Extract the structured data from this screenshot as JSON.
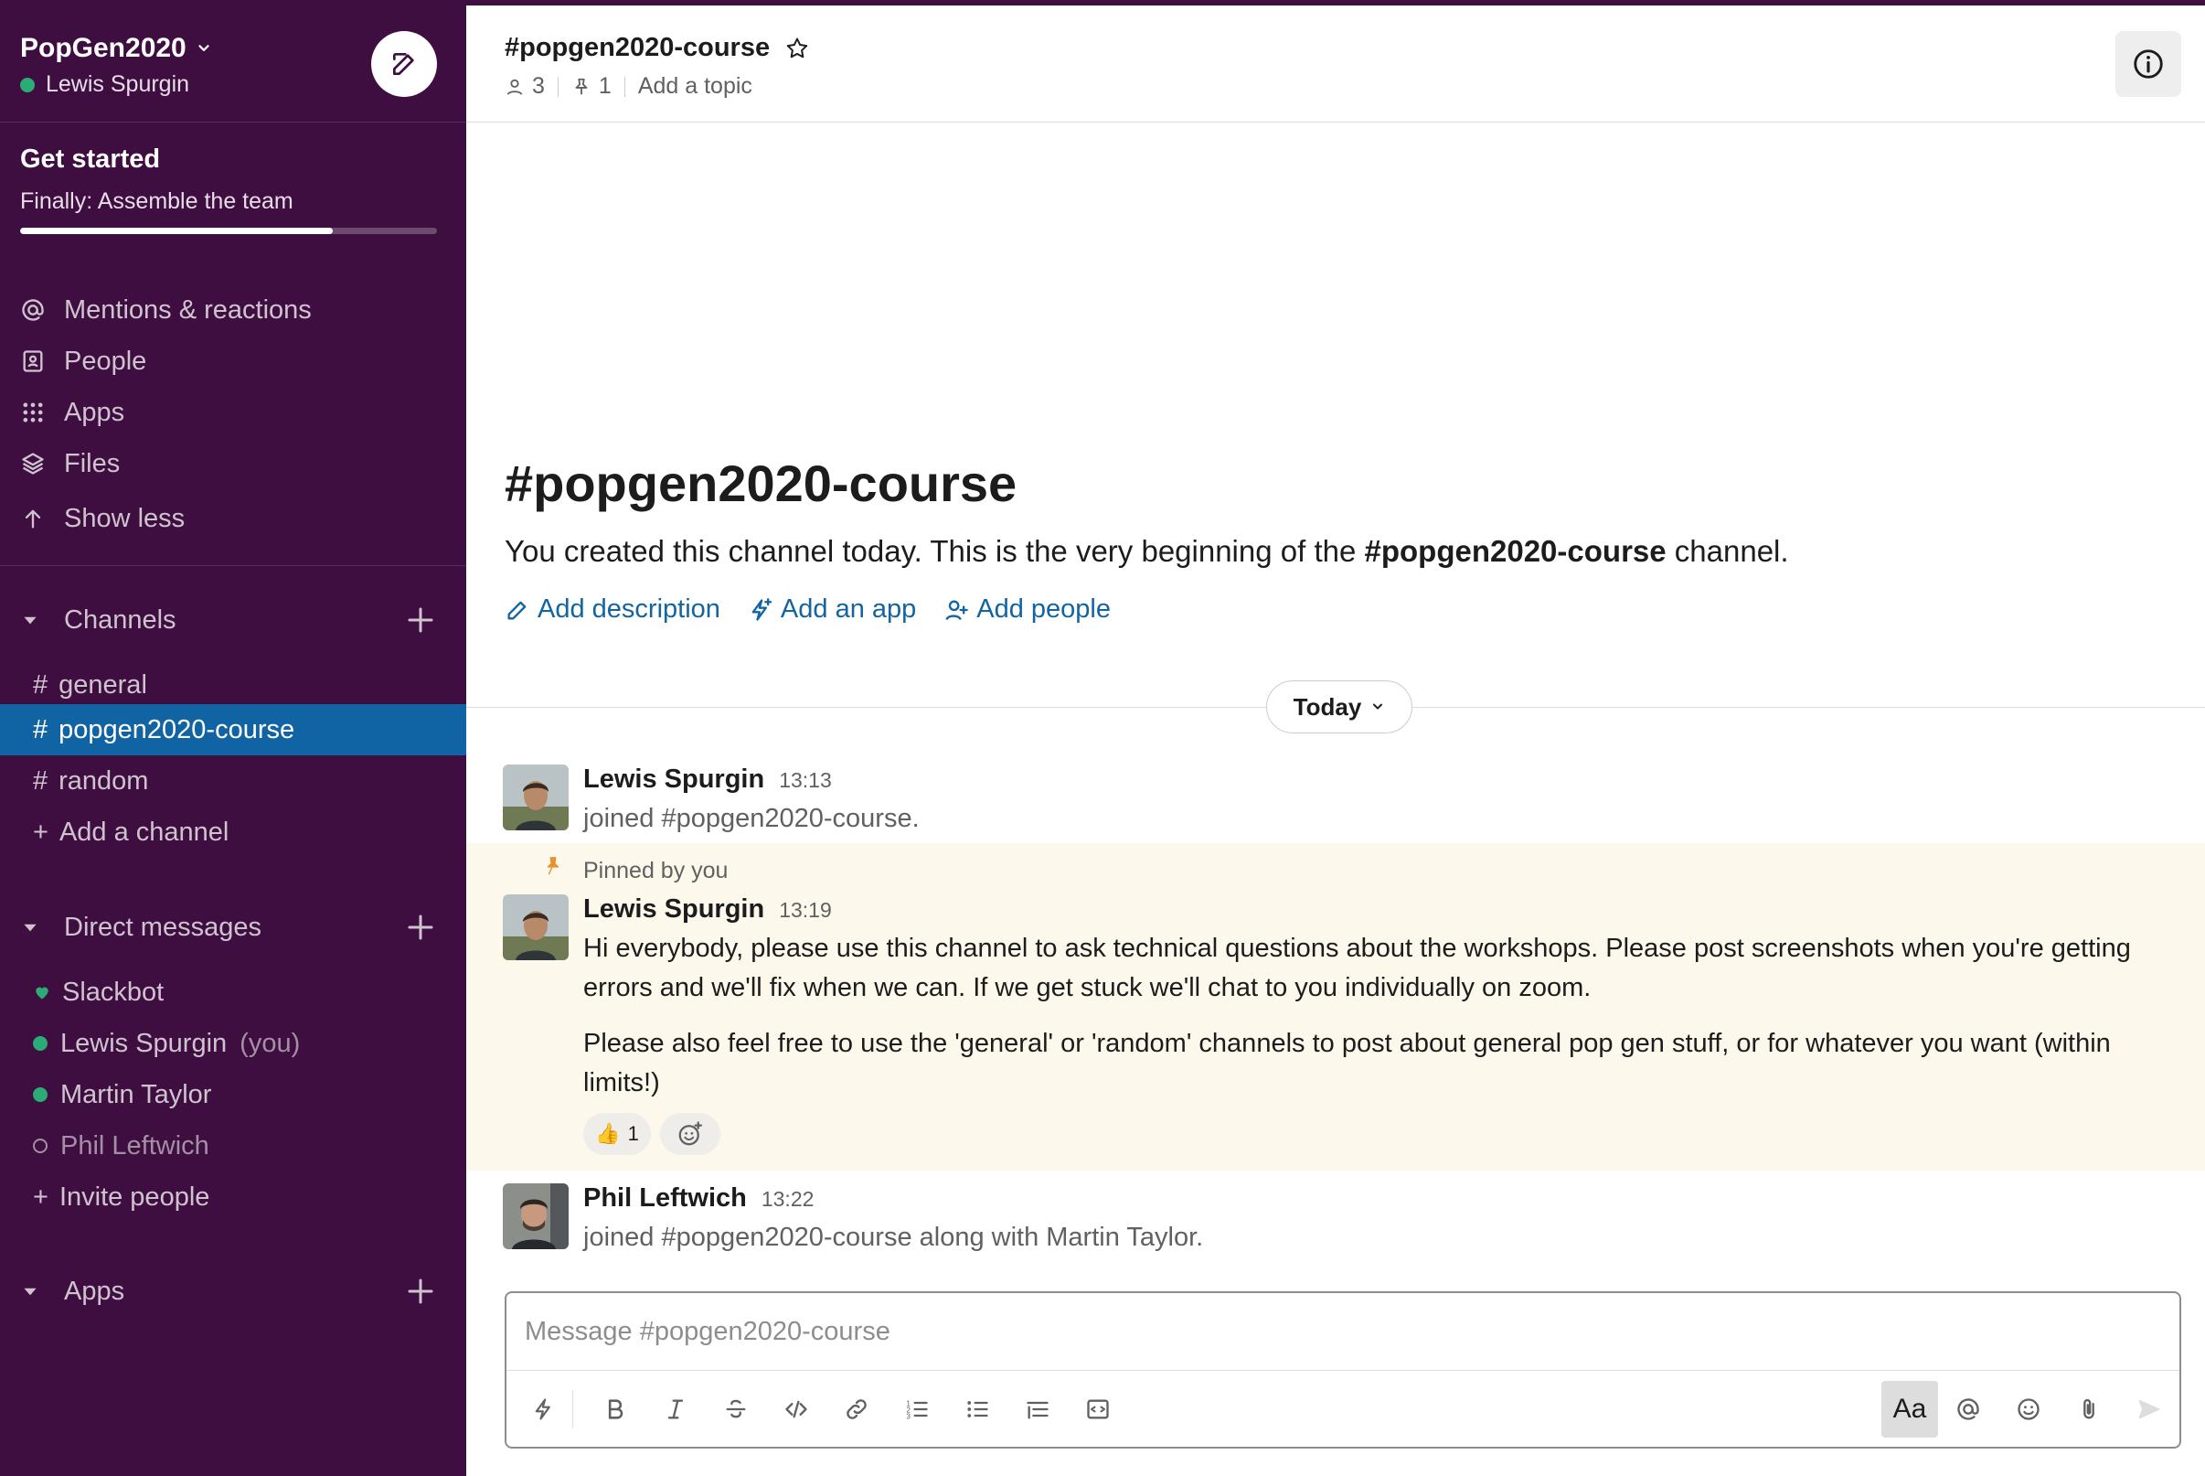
{
  "workspace": {
    "name": "PopGen2020",
    "user": "Lewis Spurgin"
  },
  "get_started": {
    "title": "Get started",
    "subtitle": "Finally: Assemble the team",
    "progress": 0.75
  },
  "nav": {
    "mentions": "Mentions & reactions",
    "people": "People",
    "apps": "Apps",
    "files": "Files",
    "show_less": "Show less"
  },
  "channels": {
    "header": "Channels",
    "items": [
      {
        "name": "general",
        "active": false
      },
      {
        "name": "popgen2020-course",
        "active": true
      },
      {
        "name": "random",
        "active": false
      }
    ],
    "add_label": "Add a channel"
  },
  "direct_messages": {
    "header": "Direct messages",
    "slackbot": "Slackbot",
    "items": [
      {
        "name": "Lewis Spurgin",
        "note": "(you)",
        "online": true
      },
      {
        "name": "Martin Taylor",
        "note": "",
        "online": true
      },
      {
        "name": "Phil Leftwich",
        "note": "",
        "online": false
      }
    ],
    "invite_label": "Invite people"
  },
  "apps_section": {
    "header": "Apps"
  },
  "channel_header": {
    "title": "#popgen2020-course",
    "member_count": "3",
    "pinned_count": "1",
    "topic_placeholder": "Add a topic"
  },
  "intro": {
    "title": "#popgen2020-course",
    "text_before": "You created this channel today. This is the very beginning of the ",
    "channel_bold": "#popgen2020-course",
    "text_after": " channel.",
    "actions": {
      "add_description": "Add description",
      "add_app": "Add an app",
      "add_people": "Add people"
    }
  },
  "day_divider": "Today",
  "messages": [
    {
      "author": "Lewis Spurgin",
      "time": "13:13",
      "text": "joined #popgen2020-course."
    },
    {
      "pinned_label": "Pinned by you",
      "author": "Lewis Spurgin",
      "time": "13:19",
      "text_1": "Hi everybody, please use this channel to ask technical questions about the workshops. Please post screenshots when you're getting errors and we'll fix when we can. If we get stuck we'll chat to you individually on zoom.",
      "text_2": "Please also feel free to use the 'general' or 'random' channels to post about general pop gen stuff, or for whatever you want (within limits!)",
      "reaction": {
        "emoji": "👍",
        "count": "1"
      }
    },
    {
      "author": "Phil Leftwich",
      "time": "13:22",
      "text": "joined #popgen2020-course along with Martin Taylor."
    }
  ],
  "composer": {
    "placeholder": "Message #popgen2020-course",
    "format_toggle": "Aa"
  },
  "colors": {
    "sidebar": "#3f0e40",
    "active": "#1164a3",
    "online": "#2bac76",
    "link": "#1264a3",
    "pinned_bg": "#fdf8ec"
  }
}
